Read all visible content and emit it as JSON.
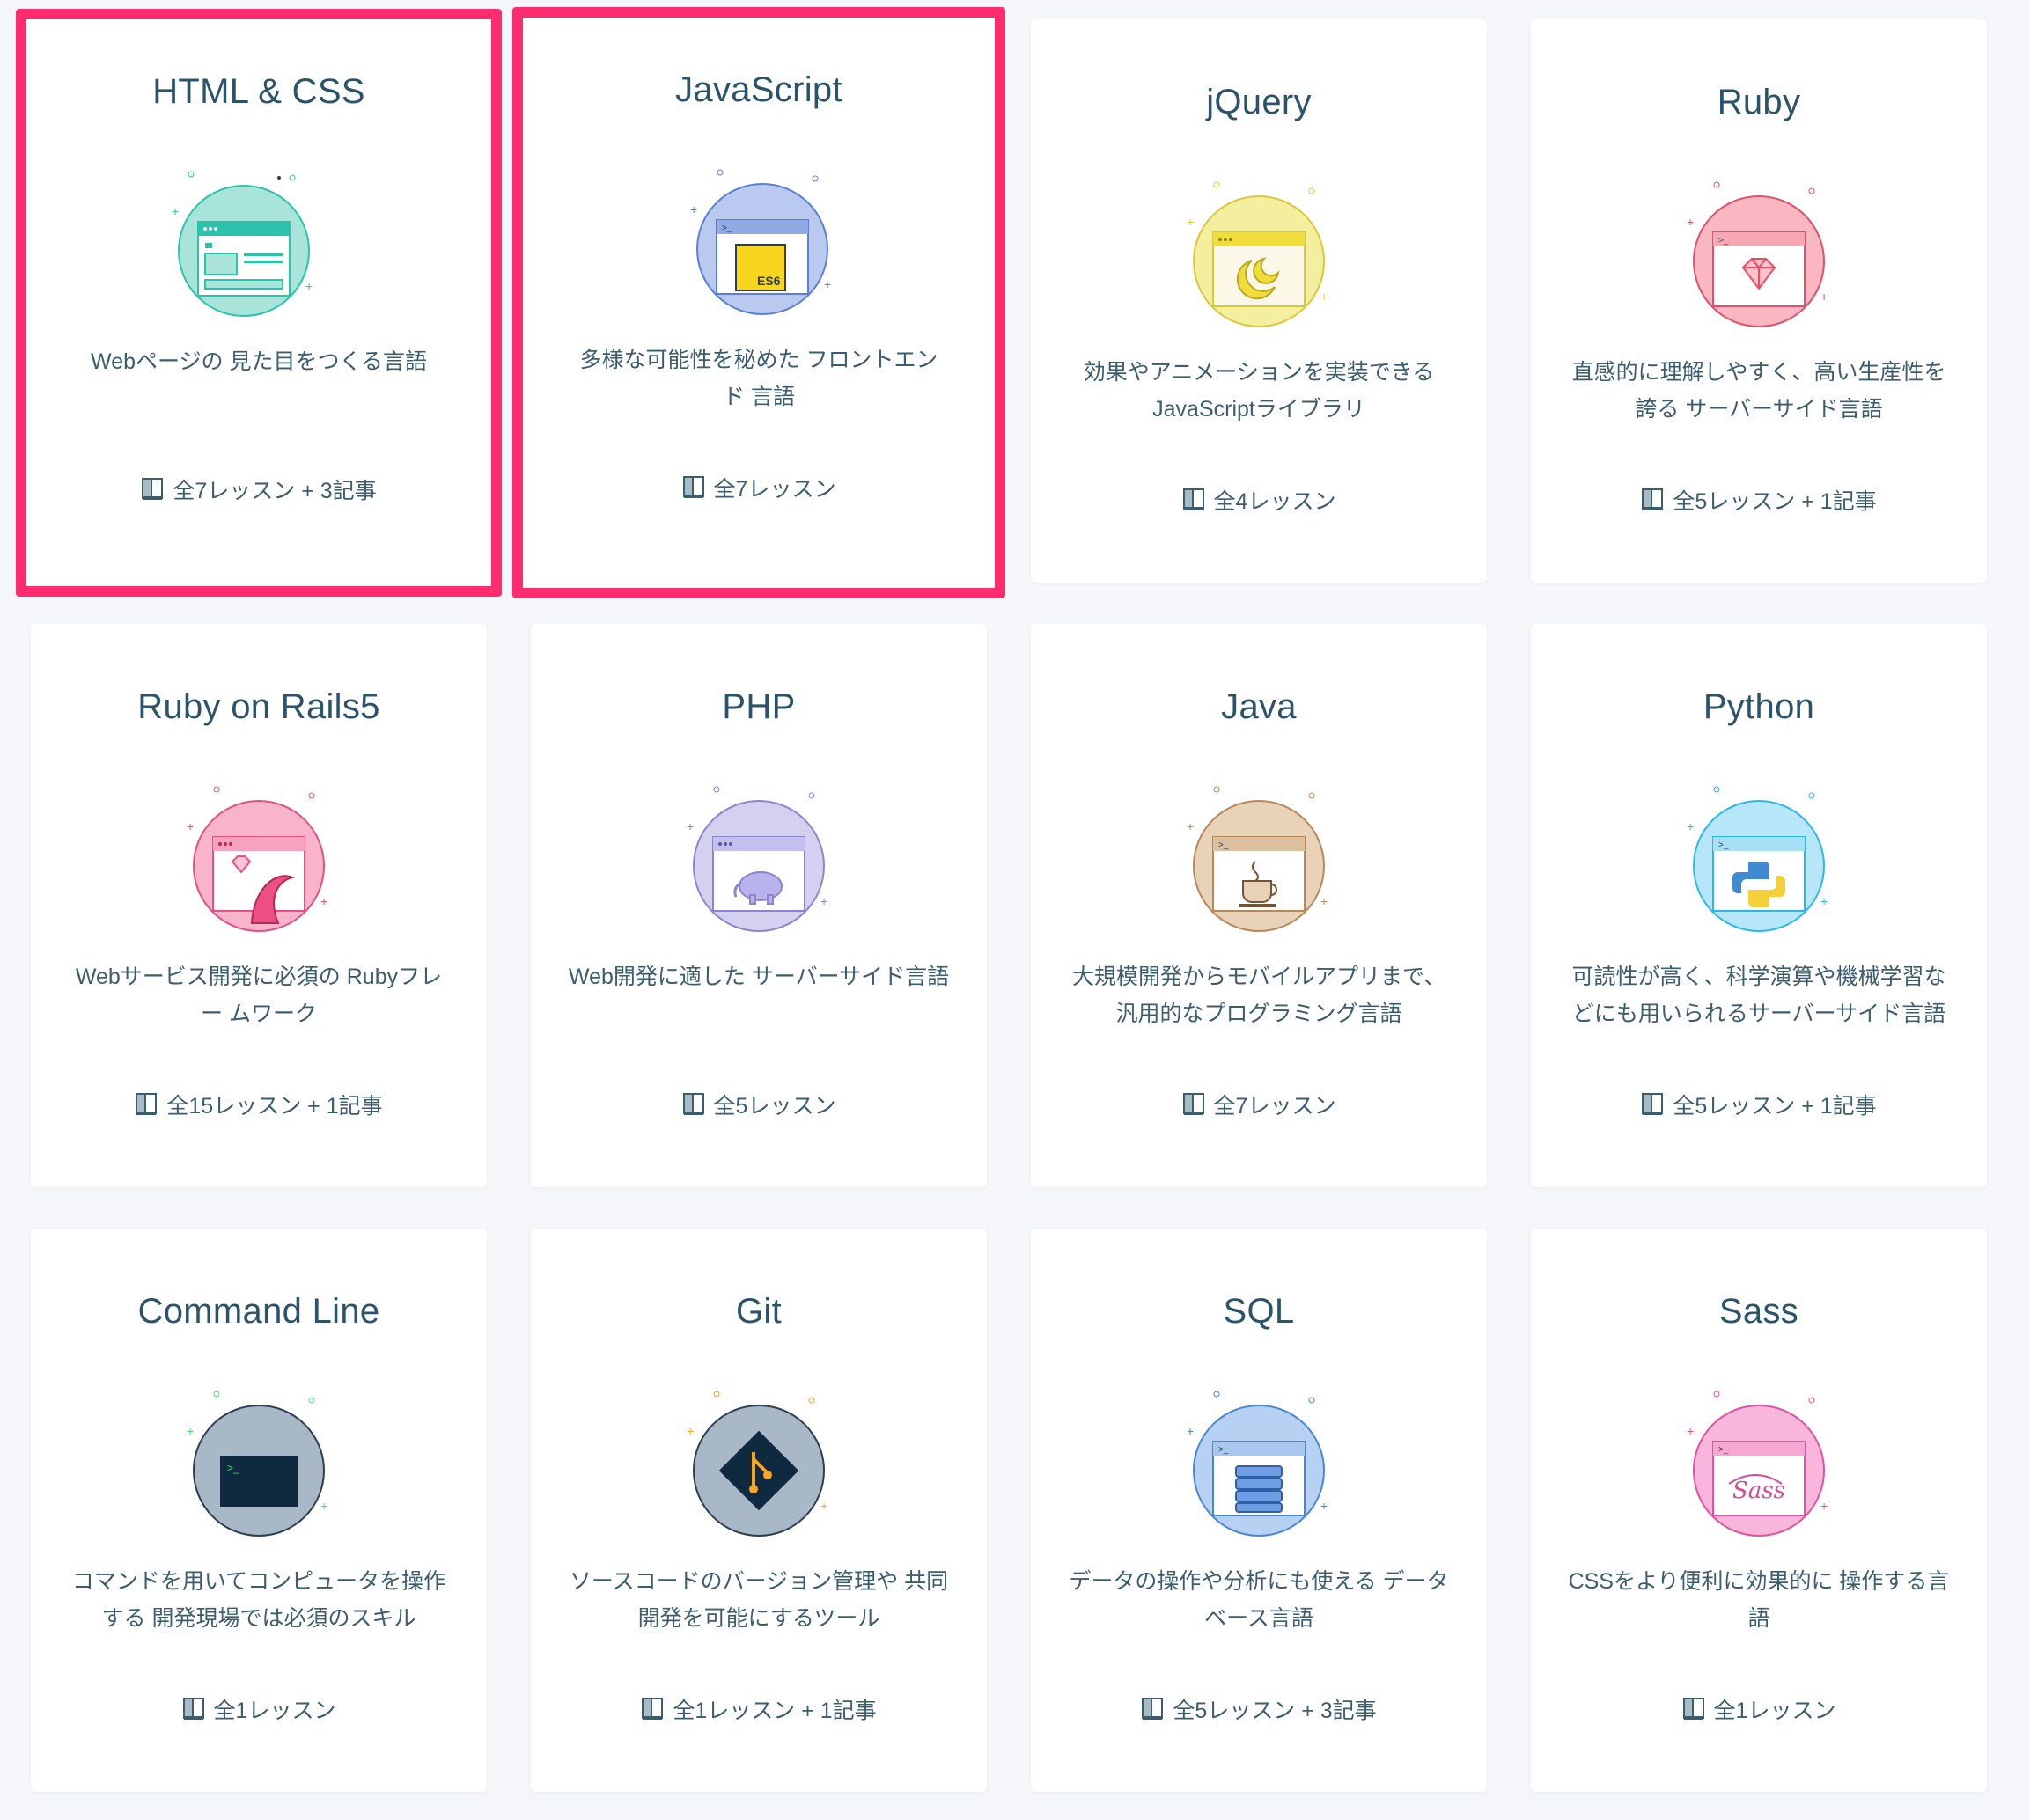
{
  "courses": [
    {
      "title": "HTML & CSS",
      "desc": "Webページの 見た目をつくる言語",
      "meta": "全7レッスン + 3記事",
      "icon": "html-css-icon",
      "color": "#2bc3aa",
      "bg": "#a8e4d9",
      "accent": "#2bc3aa",
      "selected": true
    },
    {
      "title": "JavaScript",
      "desc": "多様な可能性を秘めた フロントエンド 言語",
      "meta": "全7レッスン",
      "icon": "javascript-es6-icon",
      "color": "#5b7fd8",
      "bg": "#b9c9ef",
      "accent": "#f7d51d",
      "selected": true
    },
    {
      "title": "jQuery",
      "desc": "効果やアニメーションを実装できる JavaScriptライブラリ",
      "meta": "全4レッスン",
      "icon": "jquery-moon-icon",
      "color": "#d9c93a",
      "bg": "#f4ef9f",
      "accent": "#f0dd3c",
      "selected": false
    },
    {
      "title": "Ruby",
      "desc": "直感的に理解しやすく、高い生産性を 誇る サーバーサイド言語",
      "meta": "全5レッスン + 1記事",
      "icon": "ruby-gem-icon",
      "color": "#e0506a",
      "bg": "#f9b7c1",
      "accent": "#ee4b63",
      "selected": false
    },
    {
      "title": "Ruby on Rails5",
      "desc": "Webサービス開発に必須の Rubyフレー ムワーク",
      "meta": "全15レッスン + 1記事",
      "icon": "rails-tentacle-icon",
      "color": "#e05283",
      "bg": "#f9b4cc",
      "accent": "#ee4f82",
      "selected": false
    },
    {
      "title": "PHP",
      "desc": "Web開発に適した サーバーサイド言語",
      "meta": "全5レッスン",
      "icon": "php-elephant-icon",
      "color": "#8b84cf",
      "bg": "#d4d1f0",
      "accent": "#9a92de",
      "selected": false
    },
    {
      "title": "Java",
      "desc": "大規模開発からモバイルアプリまで、 汎用的なプログラミング言語",
      "meta": "全7レッスン",
      "icon": "java-coffee-icon",
      "color": "#b8875a",
      "bg": "#e8d2b8",
      "accent": "#a87a52",
      "selected": false
    },
    {
      "title": "Python",
      "desc": "可読性が高く、科学演算や機械学習な どにも用いられるサーバーサイド言語",
      "meta": "全5レッスン + 1記事",
      "icon": "python-logo-icon",
      "color": "#2cb8e8",
      "bg": "#b7e6f8",
      "accent": "#f3cf3a",
      "selected": false
    },
    {
      "title": "Command Line",
      "desc": "コマンドを用いてコンピュータを操作 する 開発現場では必須のスキル",
      "meta": "全1レッスン",
      "icon": "terminal-icon",
      "color": "#2c3e50",
      "bg": "#a9b8c6",
      "accent": "#0f2a40",
      "selected": false
    },
    {
      "title": "Git",
      "desc": "ソースコードのバージョン管理や 共同 開発を可能にするツール",
      "meta": "全1レッスン + 1記事",
      "icon": "git-branch-icon",
      "color": "#2c3e50",
      "bg": "#a9b8c6",
      "accent": "#f5a623",
      "selected": false
    },
    {
      "title": "SQL",
      "desc": "データの操作や分析にも使える データ ベース言語",
      "meta": "全5レッスン + 3記事",
      "icon": "sql-database-icon",
      "color": "#4a86d8",
      "bg": "#b7d1f2",
      "accent": "#6f9de3",
      "selected": false
    },
    {
      "title": "Sass",
      "desc": "CSSをより便利に効果的に 操作する言 語",
      "meta": "全1レッスン",
      "icon": "sass-logo-icon",
      "color": "#e052a0",
      "bg": "#f8b6dc",
      "accent": "#d64b93",
      "selected": false
    }
  ]
}
